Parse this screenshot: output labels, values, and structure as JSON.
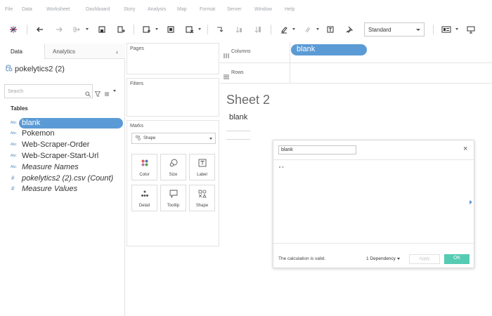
{
  "menubar": {
    "items": [
      "File",
      "Data",
      "Worksheet",
      "Dashboard",
      "Story",
      "Analysis",
      "Map",
      "Format",
      "Server",
      "Window",
      "Help"
    ]
  },
  "toolbar": {
    "fit_value": "Standard",
    "icons": [
      "tableau-logo-icon",
      "undo-icon",
      "redo-icon",
      "pause-icon",
      "save-icon",
      "new-data-source-icon",
      "new-worksheet-icon",
      "clear-sheet-icon",
      "swap-icon",
      "sort-ascending-icon",
      "sort-descending-icon",
      "highlight-icon",
      "group-icon",
      "labels-icon",
      "pin-icon",
      "show-cards-icon",
      "presentation-icon"
    ]
  },
  "data_pane": {
    "tabs": {
      "data": "Data",
      "analytics": "Analytics"
    },
    "data_source": "pokelytics2 (2)",
    "search_placeholder": "Search",
    "tables_header": "Tables",
    "fields": [
      {
        "type": "Abc",
        "name": "blank",
        "selected": true
      },
      {
        "type": "Abc",
        "name": "Pokemon"
      },
      {
        "type": "Abc",
        "name": "Web-Scraper-Order"
      },
      {
        "type": "Abc",
        "name": "Web-Scraper-Start-Url"
      },
      {
        "type": "Abc",
        "name": "Measure Names",
        "italic": true
      },
      {
        "type": "#",
        "name": "pokelytics2 (2).csv (Count)",
        "italic": true
      },
      {
        "type": "#",
        "name": "Measure Values",
        "italic": true
      }
    ]
  },
  "cards": {
    "pages_title": "Pages",
    "filters_title": "Filters",
    "marks_title": "Marks",
    "mark_type": "Shape",
    "buttons": [
      "Color",
      "Size",
      "Label",
      "Detail",
      "Tooltip",
      "Shape"
    ]
  },
  "shelves": {
    "columns_label": "Columns",
    "rows_label": "Rows",
    "column_pill": "blank"
  },
  "sheet": {
    "title": "Sheet 2",
    "header": "blank"
  },
  "calc_dialog": {
    "name": "blank",
    "formula": "\"\"",
    "status": "The calculation is valid.",
    "dependency": "1 Dependency",
    "apply_label": "Apply",
    "ok_label": "OK"
  },
  "colors": {
    "accent_blue": "#5b9bd5",
    "ok_green": "#56cbb3"
  }
}
